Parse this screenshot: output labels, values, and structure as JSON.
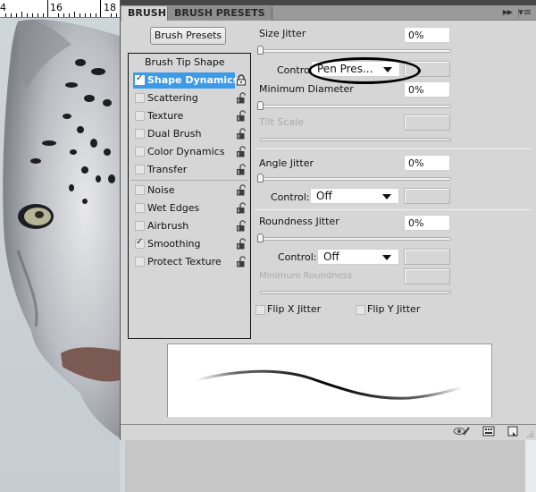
{
  "canvas": {
    "ruler_labels": [
      "4",
      "16",
      "18"
    ],
    "image_subject": "snow leopard face"
  },
  "panel": {
    "tabs": [
      {
        "label": "BRUSH",
        "active": true
      },
      {
        "label": "BRUSH PRESETS",
        "active": false
      }
    ],
    "collapse_icon": "double-arrow-right",
    "menu_icon": "panel-menu",
    "presets_button": "Brush Presets",
    "options": [
      {
        "label": "Brush Tip Shape",
        "header": true
      },
      {
        "label": "Shape Dynamics",
        "checked": true,
        "selected": true,
        "lock": "locked"
      },
      {
        "label": "Scattering",
        "checked": false,
        "lock": "unlocked"
      },
      {
        "label": "Texture",
        "checked": false,
        "lock": "unlocked"
      },
      {
        "label": "Dual Brush",
        "checked": false,
        "lock": "unlocked"
      },
      {
        "label": "Color Dynamics",
        "checked": false,
        "lock": "unlocked"
      },
      {
        "label": "Transfer",
        "checked": false,
        "lock": "unlocked"
      },
      {
        "label": "Noise",
        "checked": false,
        "lock": "unlocked"
      },
      {
        "label": "Wet Edges",
        "checked": false,
        "lock": "unlocked"
      },
      {
        "label": "Airbrush",
        "checked": false,
        "lock": "unlocked"
      },
      {
        "label": "Smoothing",
        "checked": true,
        "lock": "unlocked"
      },
      {
        "label": "Protect Texture",
        "checked": false,
        "lock": "unlocked"
      }
    ],
    "settings": {
      "size_jitter": {
        "label": "Size Jitter",
        "value": "0%",
        "slider_value": 0
      },
      "size_control": {
        "label": "Control:",
        "value": "Pen Pres..."
      },
      "minimum_diameter": {
        "label": "Minimum Diameter",
        "value": "0%",
        "slider_value": 0
      },
      "tilt_scale": {
        "label": "Tilt Scale",
        "value": "",
        "disabled": true
      },
      "angle_jitter": {
        "label": "Angle Jitter",
        "value": "0%",
        "slider_value": 0
      },
      "angle_control": {
        "label": "Control:",
        "value": "Off"
      },
      "roundness_jitter": {
        "label": "Roundness Jitter",
        "value": "0%",
        "slider_value": 0
      },
      "roundness_control": {
        "label": "Control:",
        "value": "Off"
      },
      "minimum_roundness": {
        "label": "Minimum Roundness",
        "value": "",
        "disabled": true
      },
      "flip_x": {
        "label": "Flip X Jitter",
        "checked": false
      },
      "flip_y": {
        "label": "Flip Y Jitter",
        "checked": false
      }
    },
    "footer_icons": [
      "toggle-live-tip-preview-icon",
      "open-preset-manager-icon",
      "create-new-brush-icon"
    ],
    "annotation": "black ellipse highlighting Pen Pressure control"
  }
}
